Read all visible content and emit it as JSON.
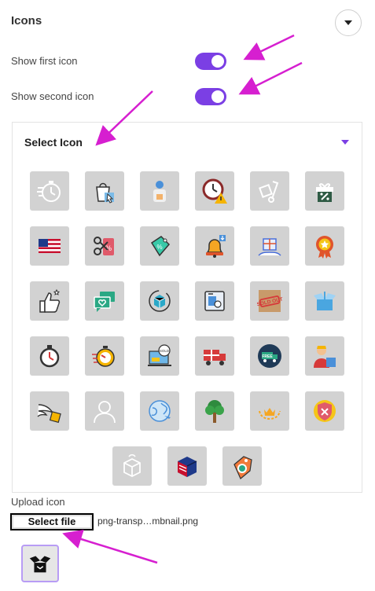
{
  "section": {
    "title": "Icons"
  },
  "toggles": [
    {
      "label": "Show first icon",
      "on": true
    },
    {
      "label": "Show second icon",
      "on": true
    }
  ],
  "panel": {
    "title": "Select Icon"
  },
  "icons": [
    [
      "timer-icon",
      "shopping-bag-cursor-icon",
      "delivery-person-icon",
      "clock-warning-icon",
      "hand-truck-icon",
      "gift-box-icon"
    ],
    [
      "us-flag-icon",
      "scissors-discount-icon",
      "discount-tag-icon",
      "sale-bell-icon",
      "gift-hands-icon",
      "award-badge-icon"
    ],
    [
      "thumbs-up-icon",
      "chat-heart-icon",
      "box-return-icon",
      "shop-box-icon",
      "sold-out-box-icon",
      "open-box-icon"
    ],
    [
      "stopwatch-icon",
      "fast-clock-icon",
      "sold-out-laptop-icon",
      "delivery-truck-gift-icon",
      "free-delivery-icon",
      "courier-box-icon"
    ],
    [
      "wings-box-icon",
      "person-outline-icon",
      "globe-plane-icon",
      "tree-icon",
      "crown-laurel-icon",
      "shield-x-icon"
    ],
    [
      "box-return-outline-icon",
      "us-shipping-box-icon",
      "whatsapp-tag-icon"
    ]
  ],
  "upload": {
    "label": "Upload icon",
    "button_label": "Select file",
    "file_name": "png-transp…mbnail.png"
  },
  "colors": {
    "accent": "#7b3fe4",
    "annotation_arrow": "#d61fd0",
    "tile_bg": "#d2d2d2"
  }
}
